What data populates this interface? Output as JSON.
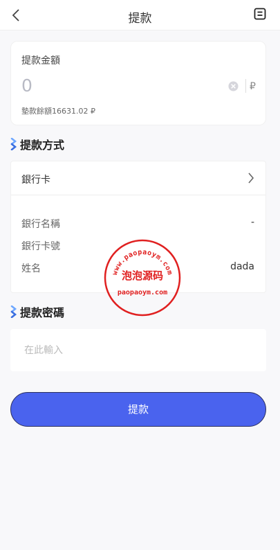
{
  "header": {
    "title": "提款"
  },
  "amount": {
    "label": "提款金額",
    "value": "0",
    "currency": "₽",
    "balance": "墊款餘額16631.02 ₽"
  },
  "method_section": {
    "title": "提款方式",
    "selected": "銀行卡",
    "fields": [
      {
        "label": "銀行名稱",
        "value": "-"
      },
      {
        "label": "銀行卡號",
        "value": ""
      },
      {
        "label": "姓名",
        "value": "dada"
      }
    ]
  },
  "password_section": {
    "title": "提款密碼",
    "placeholder": "在此輸入"
  },
  "submit_label": "提款",
  "watermark": {
    "top": "www.paopaoym.com",
    "middle": "泡泡源码",
    "bottom": "paopaoym.com"
  },
  "colors": {
    "accent": "#4a63ee",
    "stamp": "#e02020",
    "section_icon": "#3b82f6"
  }
}
